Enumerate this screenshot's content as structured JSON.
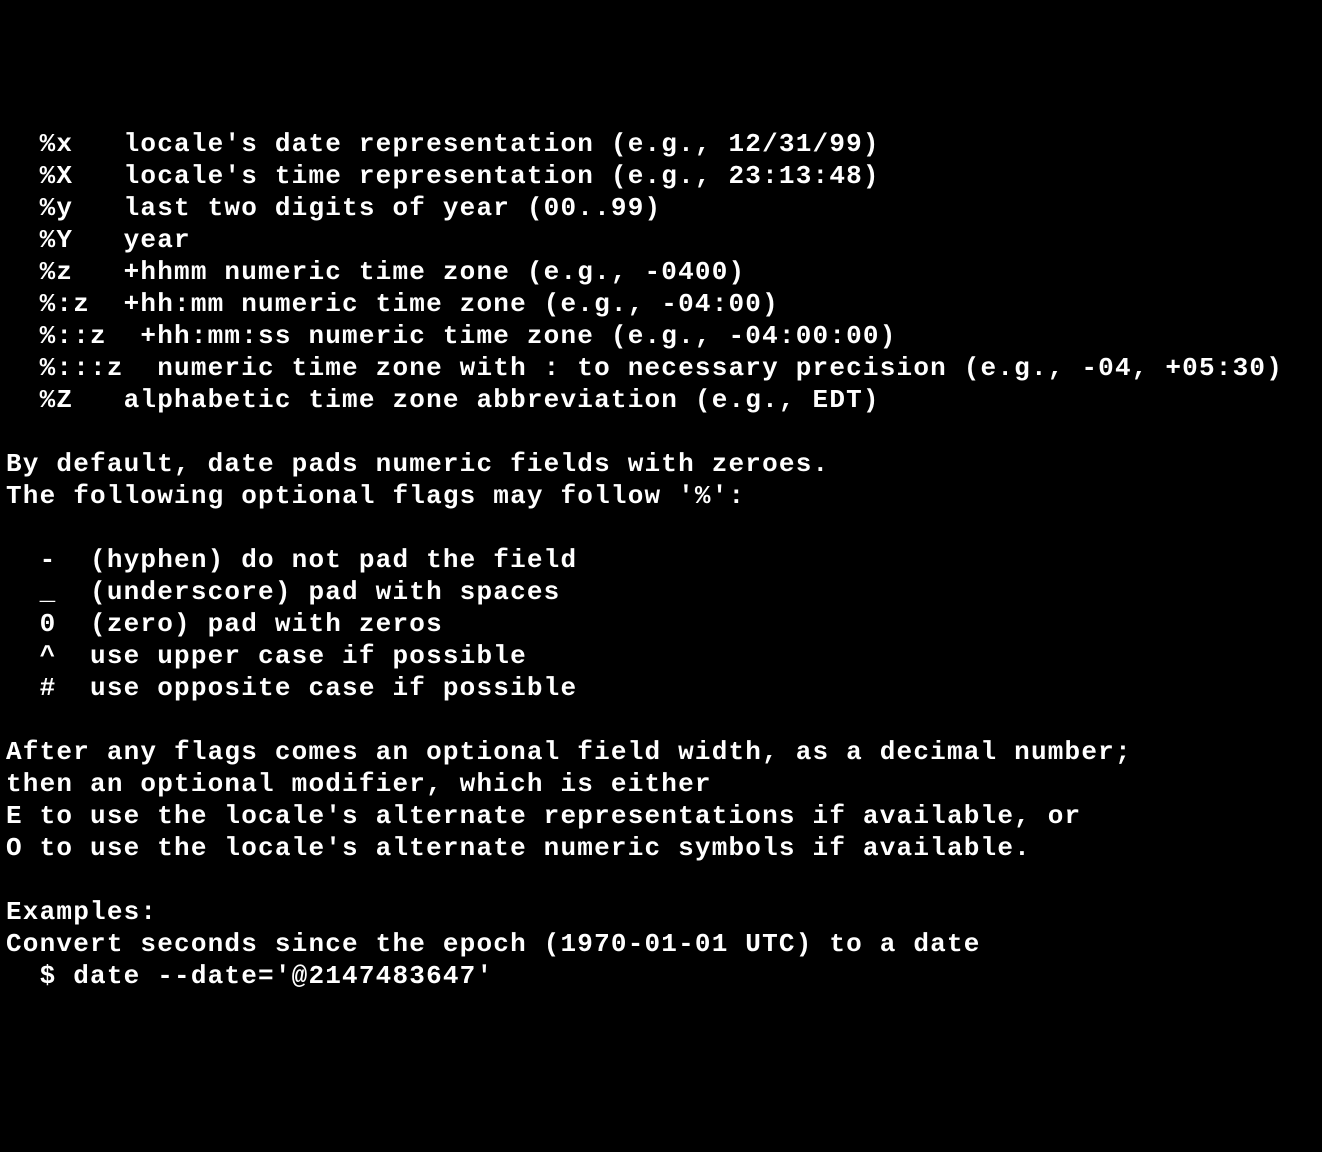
{
  "lines": [
    "  %x   locale's date representation (e.g., 12/31/99)",
    "  %X   locale's time representation (e.g., 23:13:48)",
    "  %y   last two digits of year (00..99)",
    "  %Y   year",
    "  %z   +hhmm numeric time zone (e.g., -0400)",
    "  %:z  +hh:mm numeric time zone (e.g., -04:00)",
    "  %::z  +hh:mm:ss numeric time zone (e.g., -04:00:00)",
    "  %:::z  numeric time zone with : to necessary precision (e.g., -04, +05:30)",
    "  %Z   alphabetic time zone abbreviation (e.g., EDT)",
    "",
    "By default, date pads numeric fields with zeroes.",
    "The following optional flags may follow '%':",
    "",
    "  -  (hyphen) do not pad the field",
    "  _  (underscore) pad with spaces",
    "  0  (zero) pad with zeros",
    "  ^  use upper case if possible",
    "  #  use opposite case if possible",
    "",
    "After any flags comes an optional field width, as a decimal number;",
    "then an optional modifier, which is either",
    "E to use the locale's alternate representations if available, or",
    "O to use the locale's alternate numeric symbols if available.",
    "",
    "Examples:",
    "Convert seconds since the epoch (1970-01-01 UTC) to a date",
    "  $ date --date='@2147483647'"
  ]
}
